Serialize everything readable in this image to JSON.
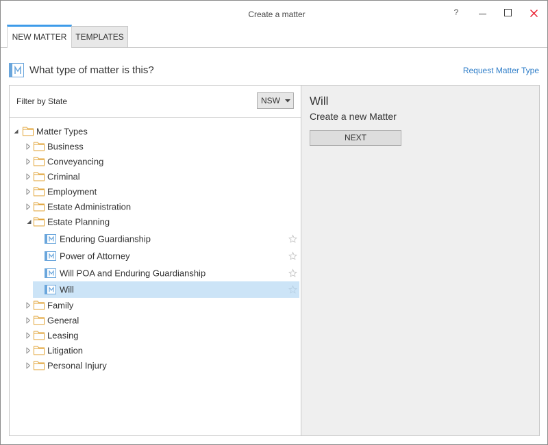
{
  "window": {
    "title": "Create a matter",
    "help_label": "?"
  },
  "tabs": [
    {
      "label": "NEW MATTER",
      "active": true
    },
    {
      "label": "TEMPLATES",
      "active": false
    }
  ],
  "header": {
    "question": "What type of matter is this?",
    "request_link": "Request Matter Type"
  },
  "filter": {
    "label": "Filter by State",
    "selected": "NSW"
  },
  "tree": {
    "root_label": "Matter Types",
    "root_expanded": true,
    "categories": [
      {
        "label": "Business",
        "expanded": false
      },
      {
        "label": "Conveyancing",
        "expanded": false
      },
      {
        "label": "Criminal",
        "expanded": false
      },
      {
        "label": "Employment",
        "expanded": false
      },
      {
        "label": "Estate Administration",
        "expanded": false
      },
      {
        "label": "Estate Planning",
        "expanded": true,
        "children": [
          {
            "label": "Enduring Guardianship",
            "selected": false
          },
          {
            "label": "Power of Attorney",
            "selected": false
          },
          {
            "label": "Will POA and Enduring Guardianship",
            "selected": false
          },
          {
            "label": "Will",
            "selected": true
          }
        ]
      },
      {
        "label": "Family",
        "expanded": false
      },
      {
        "label": "General",
        "expanded": false
      },
      {
        "label": "Leasing",
        "expanded": false
      },
      {
        "label": "Litigation",
        "expanded": false
      },
      {
        "label": "Personal Injury",
        "expanded": false
      }
    ]
  },
  "detail": {
    "title": "Will",
    "subtitle": "Create a new Matter",
    "next_label": "NEXT"
  },
  "icons": [
    "matter-icon",
    "folder-icon",
    "expand-arrow-icon",
    "collapse-arrow-icon",
    "favorite-star-icon",
    "dropdown-arrow-icon",
    "minimize-icon",
    "maximize-icon",
    "close-icon"
  ],
  "colors": {
    "accent": "#3d9be9",
    "link": "#2e7dc8",
    "close": "#e81123",
    "folder": "#e0a030",
    "matter": "#6aa6dc",
    "selected": "#cce4f7",
    "detail_bg": "#efefef"
  }
}
